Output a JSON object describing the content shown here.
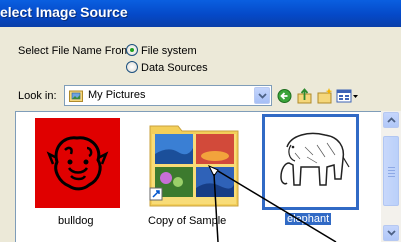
{
  "window": {
    "title": "elect Image Source"
  },
  "select_from": {
    "label": "Select File Name From:",
    "options": [
      {
        "label": "File system",
        "selected": true
      },
      {
        "label": "Data Sources",
        "selected": false
      }
    ]
  },
  "look_in": {
    "label": "Look in:",
    "value": "My Pictures",
    "toolbar_icons": [
      "back-icon",
      "up-folder-icon",
      "new-folder-icon",
      "view-menu-icon"
    ]
  },
  "files": [
    {
      "name": "bulldog",
      "selected": false
    },
    {
      "name": "Copy of Sample",
      "selected": false
    },
    {
      "name": "elephant",
      "selected": true
    }
  ],
  "colors": {
    "title_bar": "#0a5fe0",
    "selection": "#316ac5",
    "dialog": "#ece9d8"
  }
}
